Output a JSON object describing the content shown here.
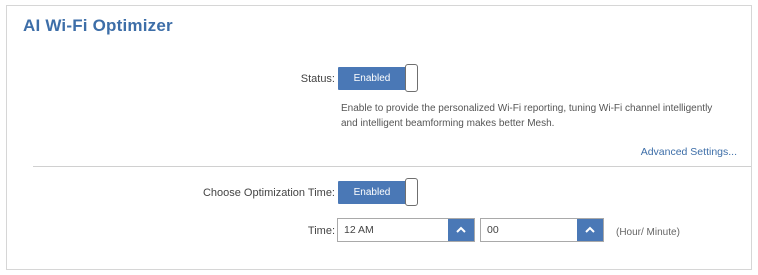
{
  "panel": {
    "title": "AI Wi-Fi Optimizer"
  },
  "status": {
    "label": "Status:",
    "toggle_text": "Enabled",
    "description": "Enable to provide the personalized Wi-Fi reporting, tuning Wi-Fi channel intelligently and intelligent beamforming makes better Mesh."
  },
  "advanced_link": "Advanced Settings...",
  "optimization": {
    "label": "Choose Optimization Time:",
    "toggle_text": "Enabled",
    "time_label": "Time:",
    "hour_value": "12 AM",
    "minute_value": "00",
    "hint": "(Hour/ Minute)"
  },
  "colors": {
    "accent": "#4a78b6",
    "title": "#3d6ea8"
  },
  "icons": {
    "dropdown": "chevron-up-icon"
  }
}
